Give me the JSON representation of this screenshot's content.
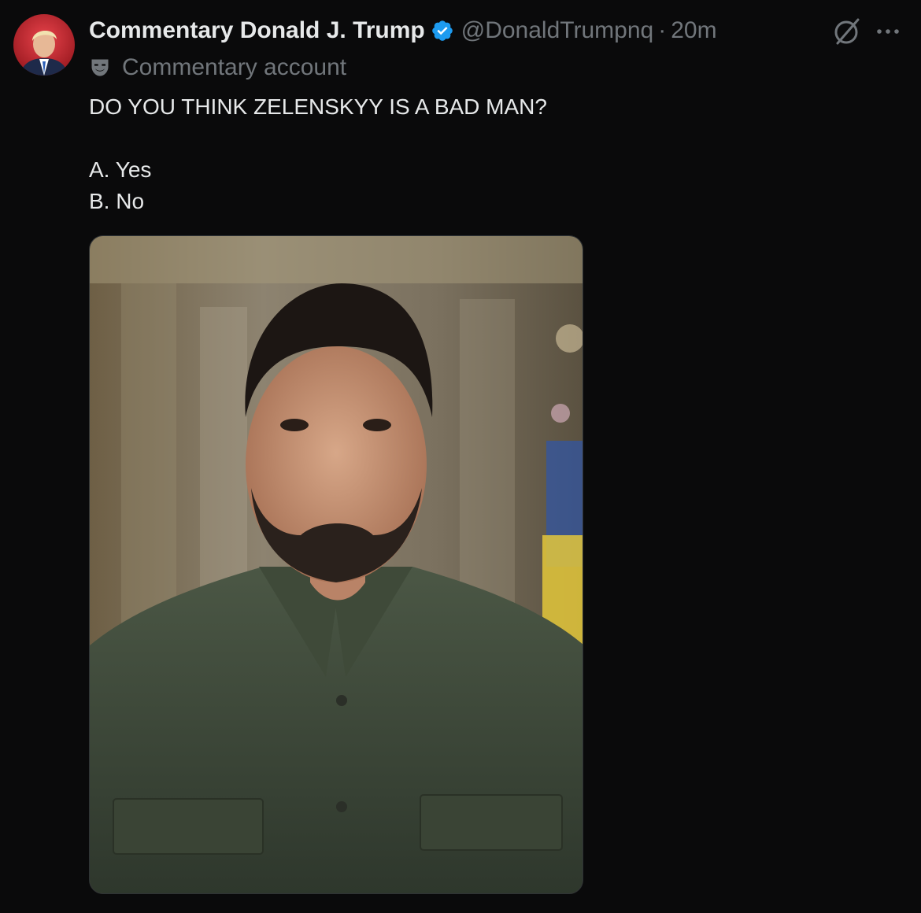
{
  "author": {
    "display_name": "Commentary Donald J. Trump",
    "handle": "@DonaldTrumpnq",
    "separator": "·",
    "timestamp": "20m",
    "account_label": "Commentary account",
    "verified_color": "#1d9bf0"
  },
  "tweet": {
    "line1": "DO YOU THINK ZELENSKYY IS A BAD MAN?",
    "option_a": "A. Yes",
    "option_b": "B. No"
  },
  "icons": {
    "avatar": "avatar",
    "verified": "verified-badge-icon",
    "label": "theater-mask-icon",
    "grok": "grok-icon",
    "more": "more-options-icon"
  },
  "media": {
    "type": "photo",
    "subject": "portrait"
  }
}
